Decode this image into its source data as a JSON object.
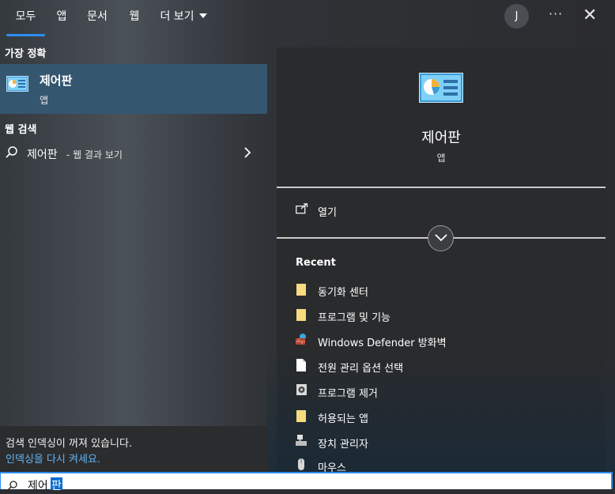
{
  "tabs": [
    {
      "label": "모두",
      "active": true
    },
    {
      "label": "앱"
    },
    {
      "label": "문서"
    },
    {
      "label": "웹"
    },
    {
      "label": "더 보기"
    }
  ],
  "header": {
    "avatar_initial": "J",
    "more_label": "···",
    "close_label": "✕"
  },
  "best_match": {
    "section_title": "가장 정확",
    "title": "제어판",
    "subtitle": "앱"
  },
  "web_search": {
    "section_title": "웹 검색",
    "query": "제어판",
    "suffix": "- 웹 결과 보기"
  },
  "indexing": {
    "line1": "검색 인덱싱이 꺼져 있습니다.",
    "line2": "인덱싱을 다시 켜세요."
  },
  "preview": {
    "title": "제어판",
    "subtitle": "앱",
    "open_label": "열기",
    "recent_title": "Recent",
    "recent": [
      {
        "label": "동기화 센터",
        "icon": "folder-icon"
      },
      {
        "label": "프로그램 및 기능",
        "icon": "folder-icon"
      },
      {
        "label": "Windows Defender 방화벽",
        "icon": "firewall-icon"
      },
      {
        "label": "전원 관리 옵션 선택",
        "icon": "document-icon"
      },
      {
        "label": "프로그램 제거",
        "icon": "uninstall-icon"
      },
      {
        "label": "허용되는 앱",
        "icon": "folder-icon"
      },
      {
        "label": "장치 관리자",
        "icon": "device-manager-icon"
      },
      {
        "label": "마우스",
        "icon": "mouse-icon"
      }
    ]
  },
  "search_box": {
    "typed": "제어",
    "selected": "판"
  },
  "colors": {
    "accent": "#2e8ef0",
    "best_match_bg": "#35566f",
    "link": "#64b5f6"
  }
}
